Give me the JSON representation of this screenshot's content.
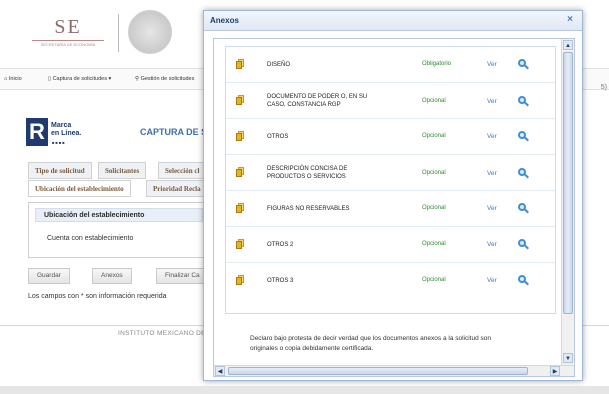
{
  "background": {
    "logo": {
      "initials": "SE",
      "subtitle": "SECRETARÍA DE ECONOMÍA"
    },
    "nav": {
      "items": [
        "Inicio",
        "Captura de solicitudes",
        "Gestión de solicitudes"
      ]
    },
    "brand": {
      "letter": "R",
      "line1": "Marca",
      "line2": "en Línea."
    },
    "page_title": "CAPTURA DE SOL",
    "tabs_row1": [
      "Tipo de solicitud",
      "Solicitantes",
      "Selección cl"
    ],
    "tabs_row2": [
      "Ubicación del establecimiento",
      "Prioridad Recla"
    ],
    "panel": {
      "header": "Ubicación del establecimiento",
      "row": "Cuenta con establecimiento"
    },
    "buttons": [
      "Guardar",
      "Anexos",
      "Finalizar Ca"
    ],
    "required_note": "Los campos con * son información requerida",
    "footer": "INSTITUTO MEXICANO DE L"
  },
  "dialog": {
    "title": "Anexos",
    "close_glyph": "×",
    "view_label": "Ver",
    "annexes": [
      {
        "name": "DISEÑO",
        "status": "Obligatorio"
      },
      {
        "name": "DOCUMENTO DE PODER O, EN SU CASO, CONSTANCIA RGP",
        "status": "Opcional"
      },
      {
        "name": "OTROS",
        "status": "Opcional"
      },
      {
        "name": "DESCRIPCIÓN CONCISA DE PRODUCTOS O SERVICIOS",
        "status": "Opcional"
      },
      {
        "name": "FIGURAS NO RESERVABLES",
        "status": "Opcional"
      },
      {
        "name": "OTROS 2",
        "status": "Opcional"
      },
      {
        "name": "OTROS 3",
        "status": "Opcional"
      }
    ],
    "declaration": "Declaro bajo protesta de decir verdad que los documentos anexos a la solicitud son originales o copia debidamente certificada."
  },
  "colors": {
    "obligatorio": "#2f8a2f",
    "opcional": "#2f8a2f",
    "link": "#3a78c4",
    "dialog_title": "#1c3e6e"
  }
}
